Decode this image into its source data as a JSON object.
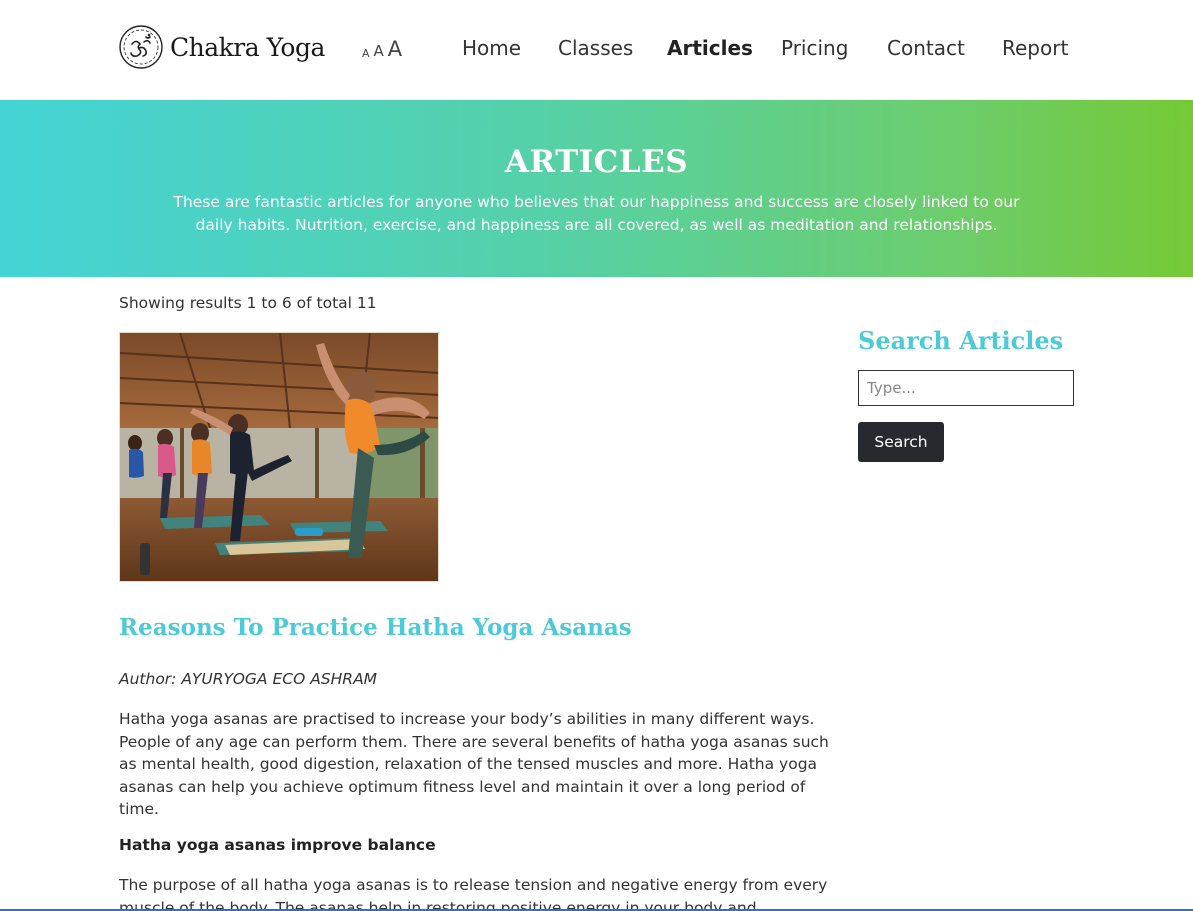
{
  "brand": {
    "name": "Chakra Yoga",
    "logo_icon": "om-icon"
  },
  "font_size_control": {
    "small": "A",
    "medium": "A",
    "large": "A"
  },
  "nav": {
    "items": [
      {
        "label": "Home",
        "active": false
      },
      {
        "label": "Classes",
        "active": false
      },
      {
        "label": "Articles",
        "active": true
      },
      {
        "label": "Pricing",
        "active": false
      },
      {
        "label": "Contact",
        "active": false
      },
      {
        "label": "Report",
        "active": false
      }
    ]
  },
  "hero": {
    "title": "ARTICLES",
    "description": "These are fantastic articles for anyone who believes that our happiness and success are closely linked to our daily habits. Nutrition, exercise, and happiness are all covered, as well as meditation and relationships.",
    "gradient_start": "#45d3d6",
    "gradient_end": "#76c935"
  },
  "results": {
    "text": "Showing results 1 to 6 of total 11"
  },
  "article": {
    "title": "Reasons To Practice Hatha Yoga Asanas",
    "author": "Author: AYURYOGA ECO ASHRAM",
    "paragraph1": "Hatha yoga asanas are practised to increase your body’s abilities in many different ways. People of any age can perform them. There are several benefits of hatha yoga asanas such as mental health, good digestion, relaxation of the tensed muscles and more. Hatha yoga asanas can help you achieve optimum fitness level and maintain it over a long period of time.",
    "subheading": "Hatha yoga asanas improve balance",
    "paragraph2": "The purpose of all hatha yoga asanas is to release tension and negative energy from every muscle of the body. The asanas help in restoring positive energy in your body and"
  },
  "sidebar": {
    "title": "Search Articles",
    "search_placeholder": "Type...",
    "search_button": "Search"
  },
  "colors": {
    "accent": "#4ccad8",
    "button": "#262a2e"
  }
}
